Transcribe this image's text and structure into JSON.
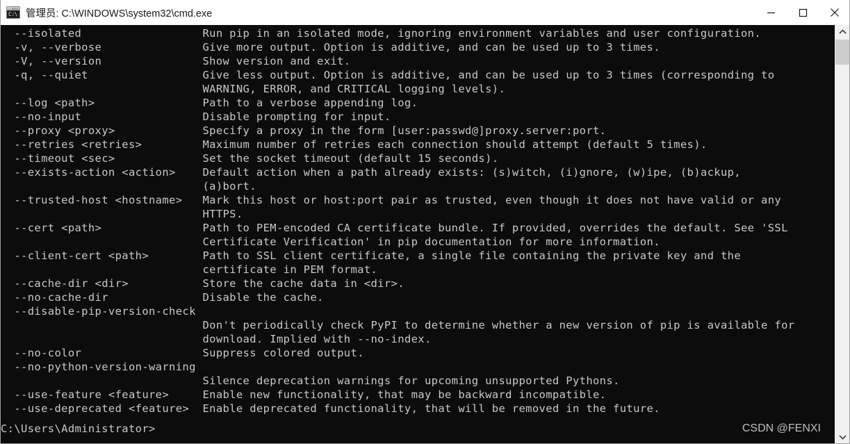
{
  "window": {
    "title": "管理员: C:\\WINDOWS\\system32\\cmd.exe",
    "icon_glyph": "C:\\",
    "background_color": "#0c0c0c",
    "text_color": "#c8c8c8",
    "titlebar_color": "#ffffff"
  },
  "titlebar_buttons": {
    "minimize": "minimize-button",
    "maximize": "maximize-button",
    "close": "close-button"
  },
  "scrollbar": {
    "up_arrow": "scroll-up-arrow",
    "down_arrow": "scroll-down-arrow",
    "thumb_color": "#cdcdcd",
    "track_color": "#f0f0f0"
  },
  "console": {
    "body": "  --isolated                  Run pip in an isolated mode, ignoring environment variables and user configuration.\n  -v, --verbose               Give more output. Option is additive, and can be used up to 3 times.\n  -V, --version               Show version and exit.\n  -q, --quiet                 Give less output. Option is additive, and can be used up to 3 times (corresponding to\n                              WARNING, ERROR, and CRITICAL logging levels).\n  --log <path>                Path to a verbose appending log.\n  --no-input                  Disable prompting for input.\n  --proxy <proxy>             Specify a proxy in the form [user:passwd@]proxy.server:port.\n  --retries <retries>         Maximum number of retries each connection should attempt (default 5 times).\n  --timeout <sec>             Set the socket timeout (default 15 seconds).\n  --exists-action <action>    Default action when a path already exists: (s)witch, (i)gnore, (w)ipe, (b)ackup,\n                              (a)bort.\n  --trusted-host <hostname>   Mark this host or host:port pair as trusted, even though it does not have valid or any\n                              HTTPS.\n  --cert <path>               Path to PEM-encoded CA certificate bundle. If provided, overrides the default. See 'SSL\n                              Certificate Verification' in pip documentation for more information.\n  --client-cert <path>        Path to SSL client certificate, a single file containing the private key and the\n                              certificate in PEM format.\n  --cache-dir <dir>           Store the cache data in <dir>.\n  --no-cache-dir              Disable the cache.\n  --disable-pip-version-check\n                              Don't periodically check PyPI to determine whether a new version of pip is available for\n                              download. Implied with --no-index.\n  --no-color                  Suppress colored output.\n  --no-python-version-warning\n                              Silence deprecation warnings for upcoming unsupported Pythons.\n  --use-feature <feature>     Enable new functionality, that may be backward incompatible.\n  --use-deprecated <feature>  Enable deprecated functionality, that will be removed in the future.",
    "prompt": "C:\\Users\\Administrator>"
  },
  "watermark": {
    "text": "CSDN @FENXI"
  }
}
